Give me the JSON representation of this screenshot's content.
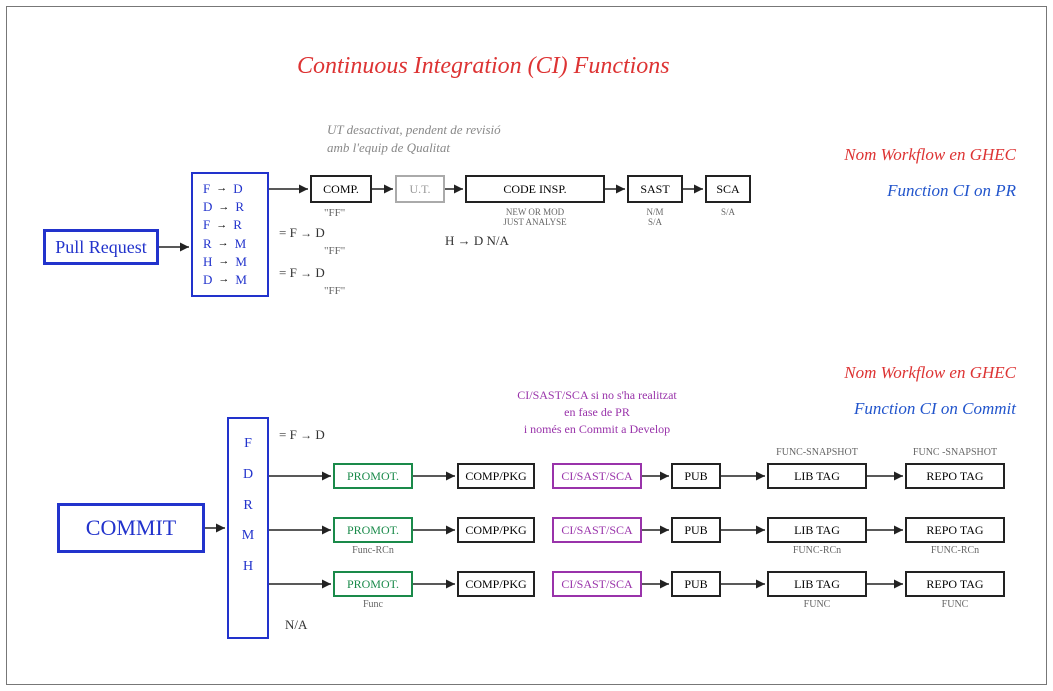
{
  "title": "Continuous Integration (CI) Functions",
  "pr": {
    "label": "Pull Request",
    "branches": [
      {
        "from": "F",
        "to": "D"
      },
      {
        "from": "D",
        "to": "R"
      },
      {
        "from": "F",
        "to": "R"
      },
      {
        "from": "R",
        "to": "M"
      },
      {
        "from": "H",
        "to": "M"
      },
      {
        "from": "D",
        "to": "M"
      }
    ],
    "note_ut": "UT desactivat, pendent de revisió\namb l'equip de Qualitat",
    "steps": {
      "comp": {
        "label": "COMP.",
        "sub": "\"FF\""
      },
      "ut": {
        "label": "U.T."
      },
      "ci": {
        "label": "CODE INSP.",
        "sub": "NEW OR MOD\nJUST ANALYSE"
      },
      "sast": {
        "label": "SAST",
        "sub": "N/M\nS/A"
      },
      "sca": {
        "label": "SCA",
        "sub": "S/A"
      }
    },
    "eq_rows": [
      {
        "lhs": "= F",
        "to": "D",
        "ff": "\"FF\""
      },
      {
        "lhs": "= F",
        "to": "D",
        "ff": "\"FF\""
      }
    ],
    "h_row": {
      "text": "H → D   N/A"
    },
    "side_title": "Nom Workflow en GHEC",
    "side_func": "Function CI on PR"
  },
  "commit": {
    "label": "COMMIT",
    "branches": [
      "F",
      "D",
      "R",
      "M",
      "H"
    ],
    "eq_row": {
      "lhs": "= F",
      "to": "D"
    },
    "h_na": "N/A",
    "note_purple": "CI/SAST/SCA si no s'ha realitzat\nen fase de PR\ni només en Commit a Develop",
    "rows": [
      {
        "promot_sub": "",
        "libtag_sub": "FUNC-SNAPSHOT",
        "repotag_sub": "FUNC -SNAPSHOT"
      },
      {
        "promot_sub": "Func-RCn",
        "libtag_sub": "FUNC-RCn",
        "repotag_sub": "FUNC-RCn"
      },
      {
        "promot_sub": "Func",
        "libtag_sub": "FUNC",
        "repotag_sub": "FUNC"
      }
    ],
    "step_labels": {
      "promot": "PROMOT.",
      "comppkg": "COMP/PKG",
      "cisast": "CI/SAST/SCA",
      "pub": "PUB",
      "libtag": "LIB TAG",
      "repotag": "REPO TAG"
    },
    "side_title": "Nom Workflow en GHEC",
    "side_func": "Function CI on Commit"
  }
}
